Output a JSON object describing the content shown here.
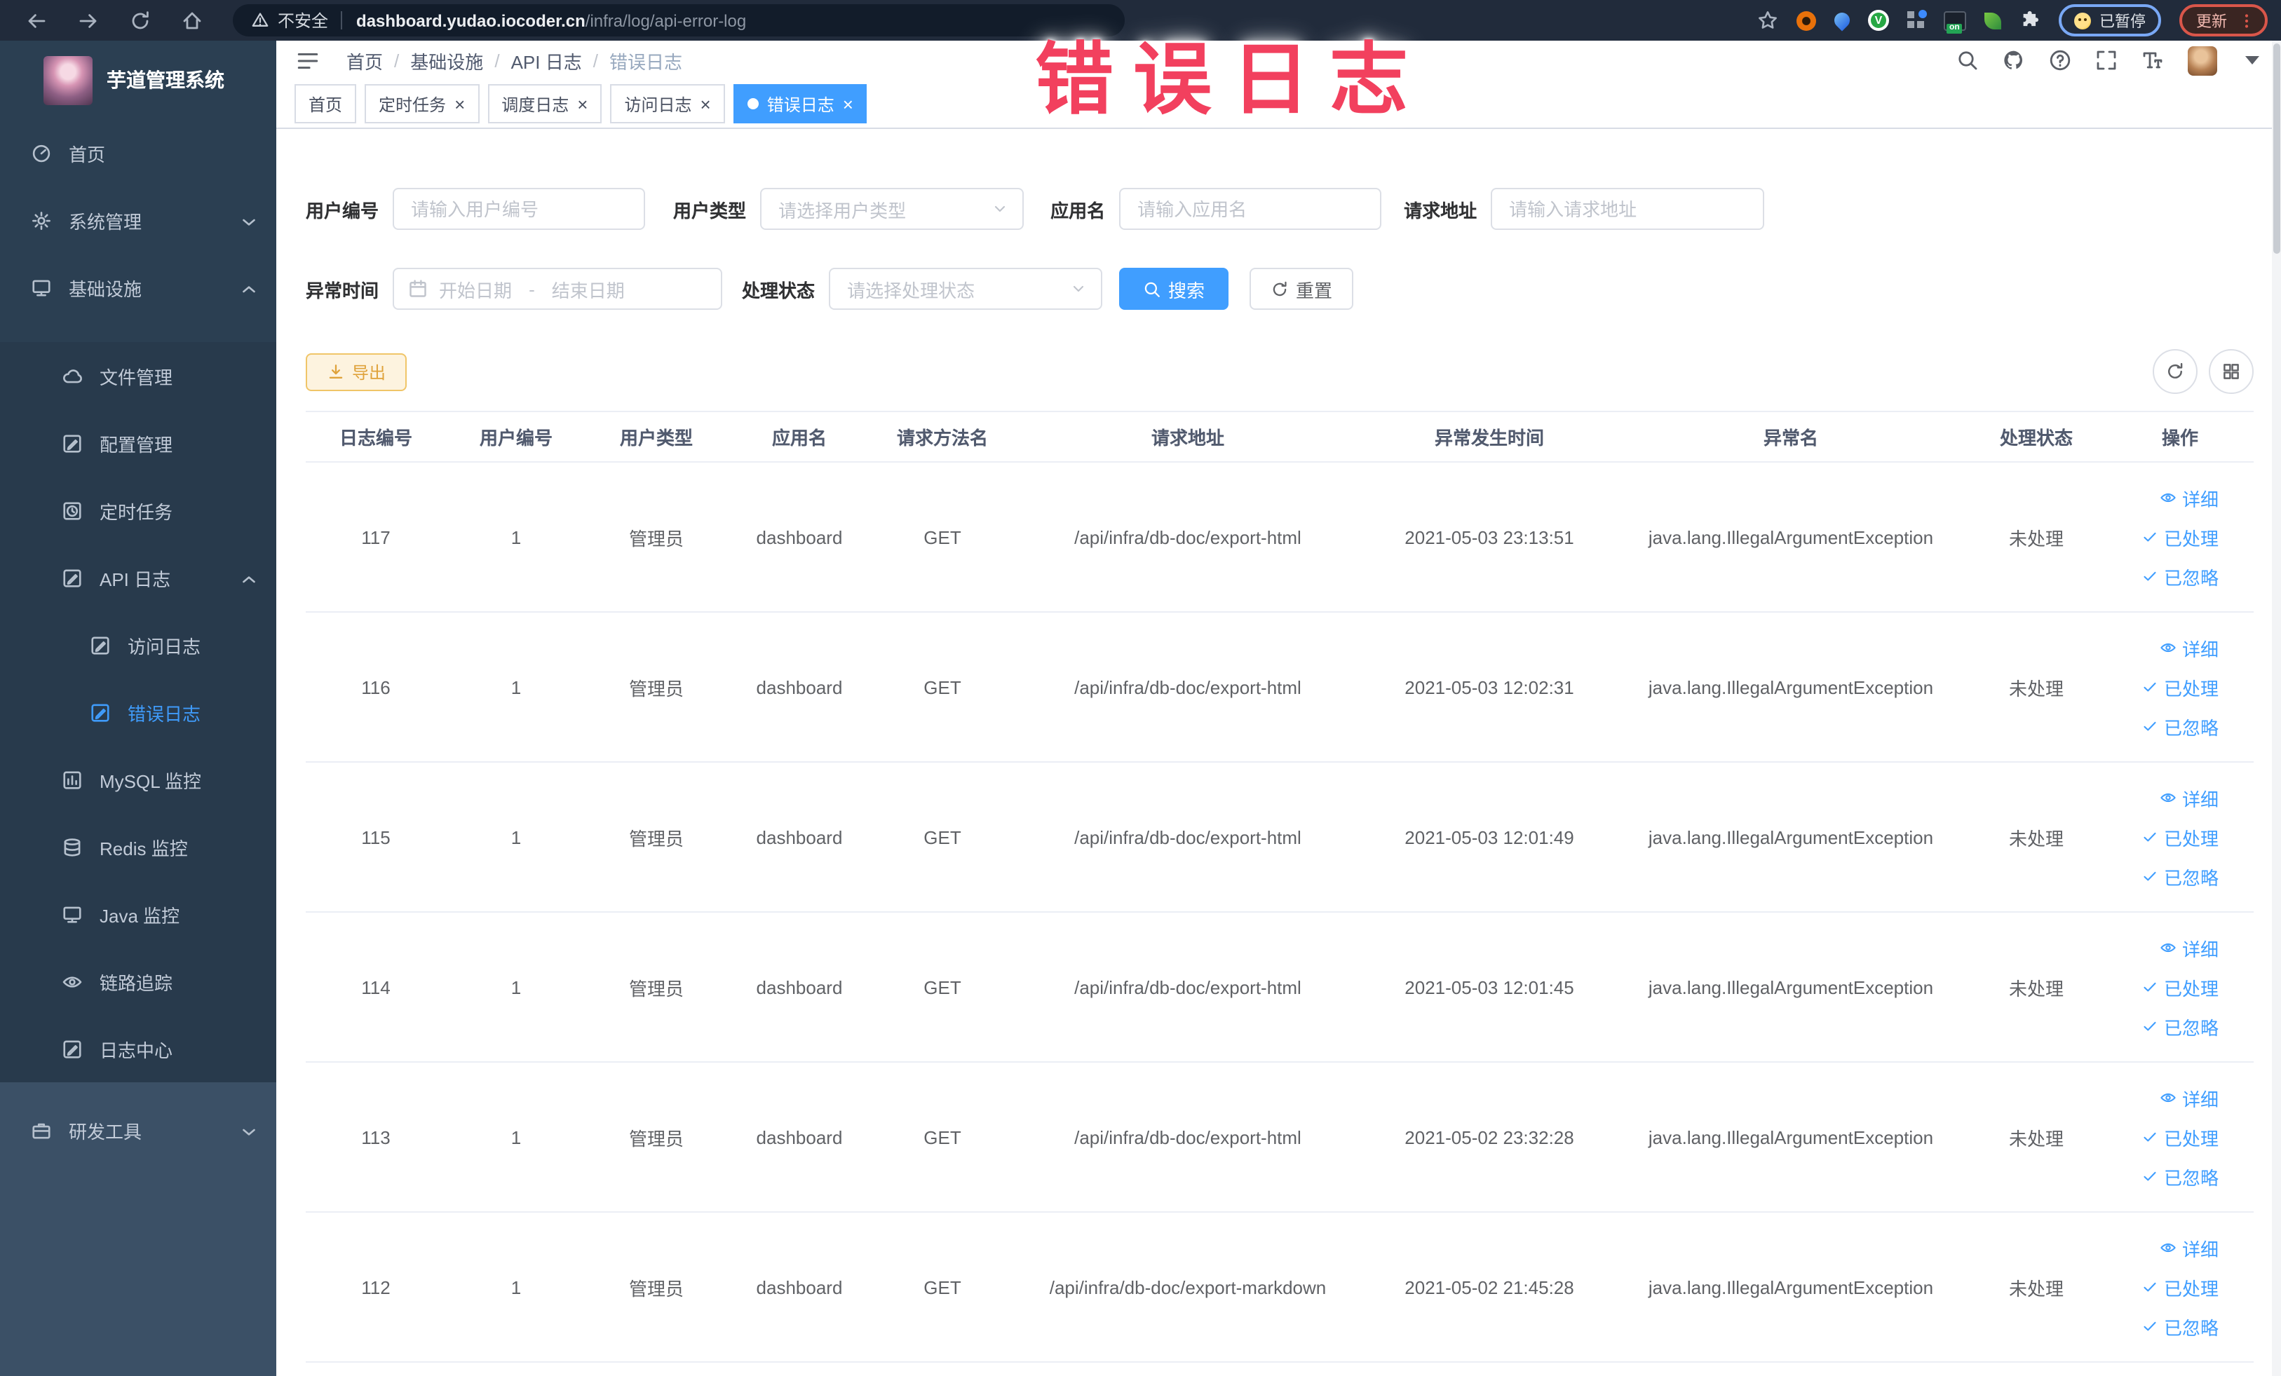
{
  "browser": {
    "security_label": "不安全",
    "url_host": "dashboard.yudao.iocoder.cn",
    "url_path": "/infra/log/api-error-log",
    "paused_badge": "已暂停",
    "update_button": "更新"
  },
  "annotation": {
    "text": "错误日志",
    "color": "#f2405e"
  },
  "sidebar": {
    "logo_title": "芋道管理系统",
    "items": [
      {
        "label": "首页",
        "icon": "dashboard-icon",
        "level": 0
      },
      {
        "label": "系统管理",
        "icon": "gear-icon",
        "level": 0,
        "chevron": "down"
      },
      {
        "label": "基础设施",
        "icon": "infra-icon",
        "level": 0,
        "chevron": "up"
      },
      {
        "label": "文件管理",
        "icon": "cloud-icon",
        "level": 1,
        "section": true,
        "gap": true
      },
      {
        "label": "配置管理",
        "icon": "edit-icon",
        "level": 1,
        "section": true
      },
      {
        "label": "定时任务",
        "icon": "clock-icon",
        "level": 1,
        "section": true
      },
      {
        "label": "API 日志",
        "icon": "log-icon",
        "level": 1,
        "section": true,
        "chevron": "up"
      },
      {
        "label": "访问日志",
        "icon": "log-icon",
        "level": 2,
        "section": true
      },
      {
        "label": "错误日志",
        "icon": "log-icon",
        "level": 2,
        "section": true,
        "active": true
      },
      {
        "label": "MySQL 监控",
        "icon": "chart-icon",
        "level": 1,
        "section": true
      },
      {
        "label": "Redis 监控",
        "icon": "database-icon",
        "level": 1,
        "section": true
      },
      {
        "label": "Java 监控",
        "icon": "monitor-icon",
        "level": 1,
        "section": true
      },
      {
        "label": "链路追踪",
        "icon": "eye-icon",
        "level": 1,
        "section": true
      },
      {
        "label": "日志中心",
        "icon": "log-icon",
        "level": 1,
        "section": true
      },
      {
        "label": "研发工具",
        "icon": "toolbox-icon",
        "level": 0,
        "chevron": "down",
        "light": true
      }
    ]
  },
  "header": {
    "breadcrumb": [
      "首页",
      "基础设施",
      "API 日志",
      "错误日志"
    ]
  },
  "tabs": [
    {
      "label": "首页",
      "closable": false,
      "active": false
    },
    {
      "label": "定时任务",
      "closable": true,
      "active": false
    },
    {
      "label": "调度日志",
      "closable": true,
      "active": false
    },
    {
      "label": "访问日志",
      "closable": true,
      "active": false
    },
    {
      "label": "错误日志",
      "closable": true,
      "active": true
    }
  ],
  "filters": {
    "user_id": {
      "label": "用户编号",
      "placeholder": "请输入用户编号"
    },
    "user_type": {
      "label": "用户类型",
      "placeholder": "请选择用户类型"
    },
    "app_name": {
      "label": "应用名",
      "placeholder": "请输入应用名"
    },
    "request_url": {
      "label": "请求地址",
      "placeholder": "请输入请求地址"
    },
    "exception_time": {
      "label": "异常时间",
      "start_placeholder": "开始日期",
      "separator": "-",
      "end_placeholder": "结束日期"
    },
    "process_status": {
      "label": "处理状态",
      "placeholder": "请选择处理状态"
    },
    "search_button": "搜索",
    "reset_button": "重置"
  },
  "toolbar": {
    "export_button": "导出"
  },
  "table": {
    "columns": [
      "日志编号",
      "用户编号",
      "用户类型",
      "应用名",
      "请求方法名",
      "请求地址",
      "异常发生时间",
      "异常名",
      "处理状态",
      "操作"
    ],
    "actions": [
      "详细",
      "已处理",
      "已忽略"
    ],
    "rows": [
      {
        "id": "117",
        "user_id": "1",
        "user_type": "管理员",
        "app": "dashboard",
        "method": "GET",
        "url": "/api/infra/db-doc/export-html",
        "time": "2021-05-03 23:13:51",
        "exception": "java.lang.IllegalArgumentException",
        "status": "未处理"
      },
      {
        "id": "116",
        "user_id": "1",
        "user_type": "管理员",
        "app": "dashboard",
        "method": "GET",
        "url": "/api/infra/db-doc/export-html",
        "time": "2021-05-03 12:02:31",
        "exception": "java.lang.IllegalArgumentException",
        "status": "未处理"
      },
      {
        "id": "115",
        "user_id": "1",
        "user_type": "管理员",
        "app": "dashboard",
        "method": "GET",
        "url": "/api/infra/db-doc/export-html",
        "time": "2021-05-03 12:01:49",
        "exception": "java.lang.IllegalArgumentException",
        "status": "未处理"
      },
      {
        "id": "114",
        "user_id": "1",
        "user_type": "管理员",
        "app": "dashboard",
        "method": "GET",
        "url": "/api/infra/db-doc/export-html",
        "time": "2021-05-03 12:01:45",
        "exception": "java.lang.IllegalArgumentException",
        "status": "未处理"
      },
      {
        "id": "113",
        "user_id": "1",
        "user_type": "管理员",
        "app": "dashboard",
        "method": "GET",
        "url": "/api/infra/db-doc/export-html",
        "time": "2021-05-02 23:32:28",
        "exception": "java.lang.IllegalArgumentException",
        "status": "未处理"
      },
      {
        "id": "112",
        "user_id": "1",
        "user_type": "管理员",
        "app": "dashboard",
        "method": "GET",
        "url": "/api/infra/db-doc/export-markdown",
        "time": "2021-05-02 21:45:28",
        "exception": "java.lang.IllegalArgumentException",
        "status": "未处理"
      }
    ]
  },
  "colors": {
    "accent": "#409eff",
    "sidebar_bg": "#2b3f52",
    "active_text": "#3f9bfa",
    "warning": "#dfa23a",
    "annotation": "#f2405e"
  }
}
